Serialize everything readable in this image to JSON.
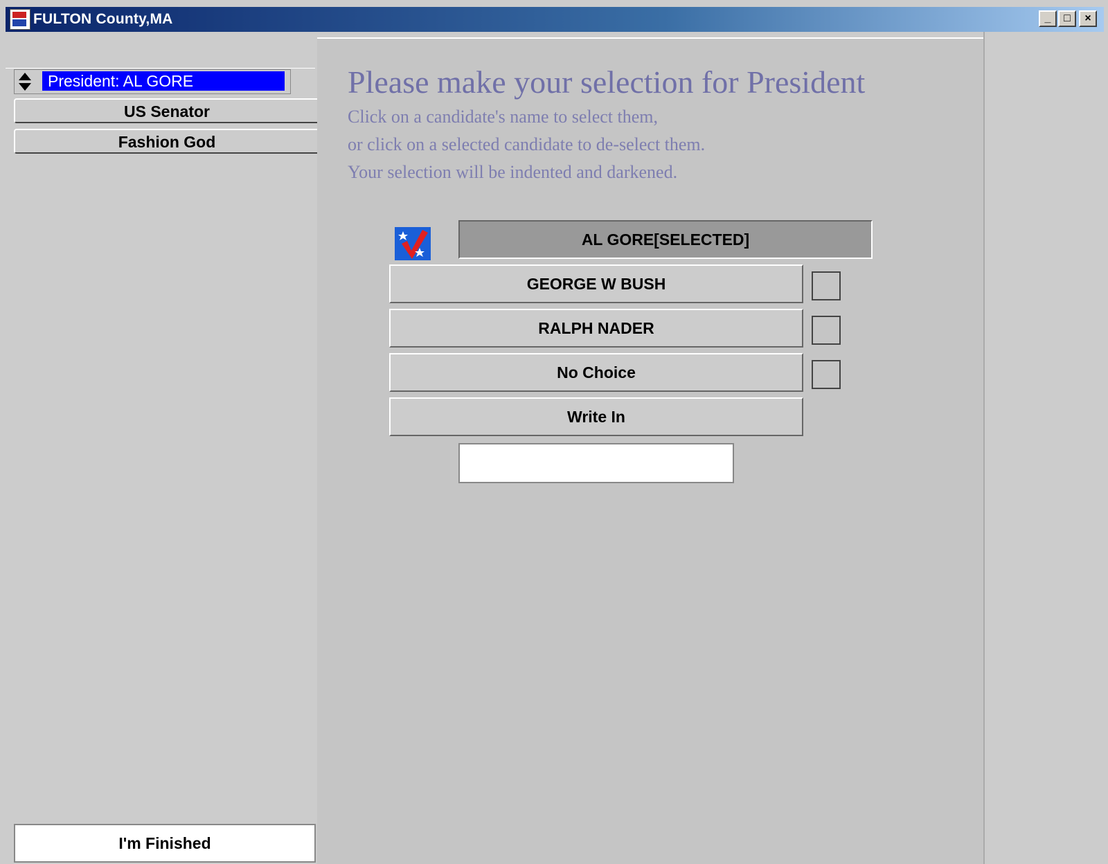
{
  "window": {
    "title": "FULTON County,MA",
    "controls": {
      "minimize": "_",
      "maximize": "□",
      "close": "×"
    }
  },
  "sidebar": {
    "current_race": "President: AL GORE",
    "races": [
      "US Senator",
      "Fashion God"
    ],
    "finish_label": "I'm Finished"
  },
  "main": {
    "heading": "Please make your selection for President",
    "instructions": [
      "Click on a candidate's name to select them,",
      "or click on a selected candidate to de-select them.",
      "Your selection will be indented and darkened."
    ],
    "selected_candidate": "AL GORE[SELECTED]",
    "candidates": [
      "GEORGE W BUSH",
      "RALPH NADER",
      "No Choice"
    ],
    "write_in_label": "Write In",
    "write_in_value": ""
  },
  "icons": {
    "app": "ballot-app-icon",
    "sort": "up-down-arrows-icon",
    "selection": "vote-checkmark-icon"
  },
  "colors": {
    "selection_highlight": "#0000ff",
    "heading_text": "#7070a8",
    "check_blue": "#1a5fd8",
    "check_red": "#e02020"
  }
}
